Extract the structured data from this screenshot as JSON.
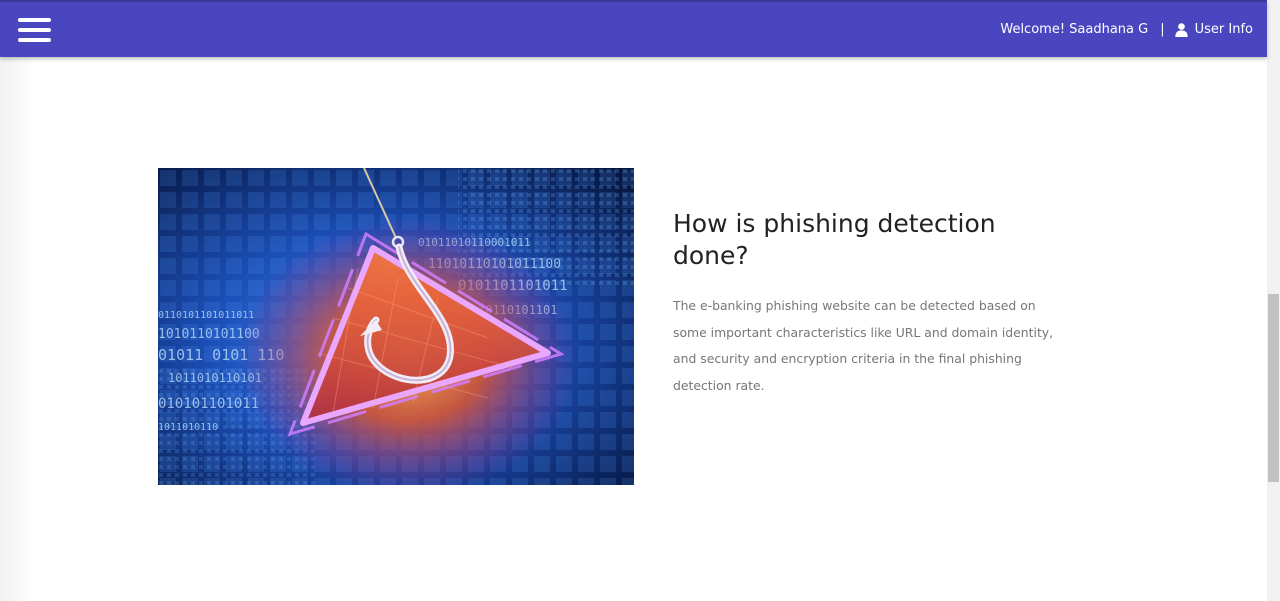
{
  "topbar": {
    "menu_icon": "hamburger-menu-icon",
    "welcome_text": "Welcome! Saadhana G",
    "separator": "|",
    "user_icon": "user-icon",
    "user_info_label": "User Info",
    "background_color": "#4a46c0"
  },
  "feature": {
    "image_icon": "phishing-hook-warning-illustration",
    "heading": "How is phishing detection done?",
    "paragraph": "The e-banking phishing website can be detected based on some important characteristics like URL and domain identity, and security and encryption criteria in the final phishing detection rate."
  }
}
